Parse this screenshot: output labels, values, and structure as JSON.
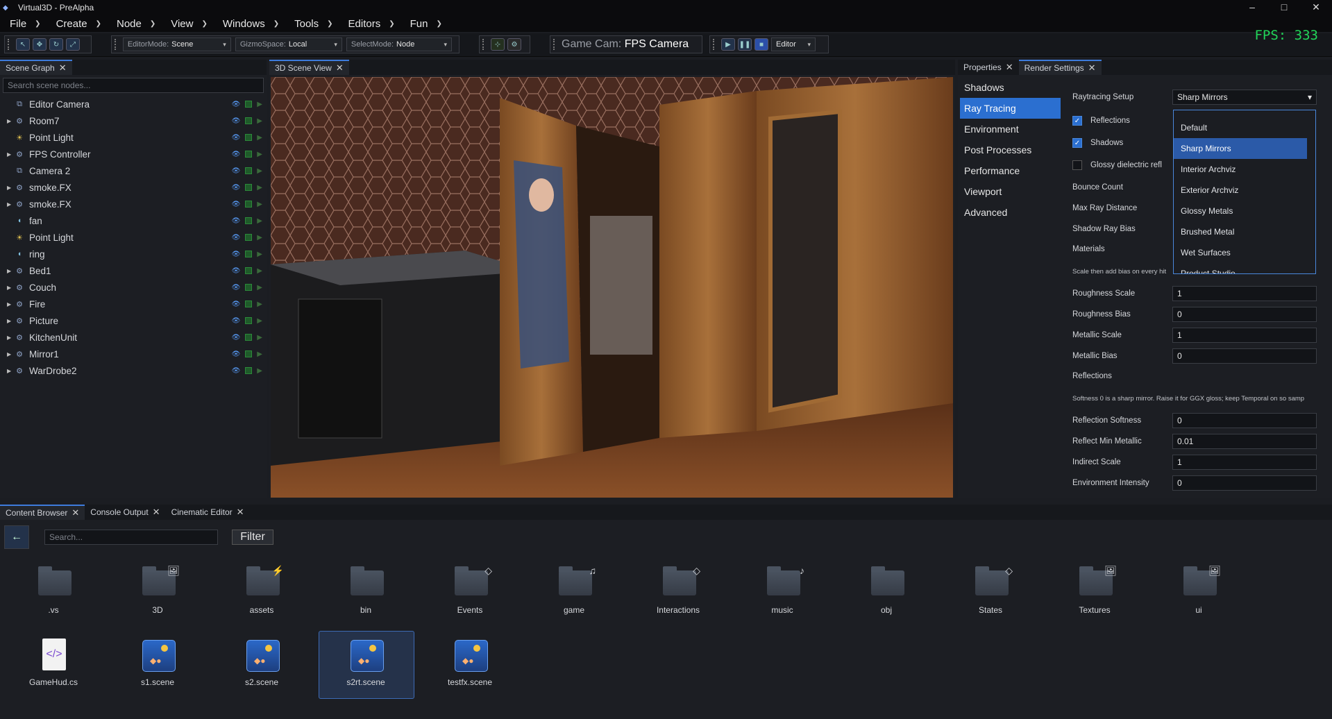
{
  "window": {
    "title": "Virtual3D - PreAlpha",
    "minimize": "–",
    "maximize": "□",
    "close": "✕"
  },
  "menu": [
    "File",
    "Create",
    "Node",
    "View",
    "Windows",
    "Tools",
    "Editors",
    "Fun"
  ],
  "toolbar": {
    "editor_mode_label": "EditorMode:",
    "editor_mode_value": "Scene",
    "gizmo_label": "GizmoSpace:",
    "gizmo_value": "Local",
    "select_label": "SelectMode:",
    "select_value": "Node",
    "game_cam_label": "Game Cam:",
    "game_cam_value": "FPS Camera",
    "play_target": "Editor"
  },
  "fps": "FPS: 333",
  "scene_graph": {
    "tab": "Scene Graph",
    "search_placeholder": "Search scene nodes...",
    "nodes": [
      {
        "name": "Editor Camera",
        "icon": "camera-icon"
      },
      {
        "name": "Room7",
        "icon": "node-icon"
      },
      {
        "name": "Point Light",
        "icon": "light-icon"
      },
      {
        "name": "FPS Controller",
        "icon": "node-icon"
      },
      {
        "name": "Camera 2",
        "icon": "camera-icon"
      },
      {
        "name": "smoke.FX",
        "icon": "node-icon"
      },
      {
        "name": "smoke.FX",
        "icon": "node-icon"
      },
      {
        "name": "fan",
        "icon": "sound-icon"
      },
      {
        "name": "Point Light",
        "icon": "light-icon"
      },
      {
        "name": "ring",
        "icon": "sound-icon"
      },
      {
        "name": "Bed1",
        "icon": "node-icon"
      },
      {
        "name": "Couch",
        "icon": "node-icon"
      },
      {
        "name": "Fire",
        "icon": "node-icon"
      },
      {
        "name": "Picture",
        "icon": "node-icon"
      },
      {
        "name": "KitchenUnit",
        "icon": "node-icon"
      },
      {
        "name": "Mirror1",
        "icon": "node-icon"
      },
      {
        "name": "WarDrobe2",
        "icon": "node-icon"
      }
    ]
  },
  "viewport": {
    "tab": "3D Scene View"
  },
  "render": {
    "tabs": [
      "Properties",
      "Render Settings"
    ],
    "sections": [
      "Shadows",
      "Ray Tracing",
      "Environment",
      "Post Processes",
      "Performance",
      "Viewport",
      "Advanced"
    ],
    "raytracing_setup_label": "Raytracing Setup",
    "raytracing_setup_value": "Sharp Mirrors",
    "reflections_label": "Reflections",
    "shadows_label": "Shadows",
    "glossy_label": "Glossy dielectric refl",
    "bounce_label": "Bounce Count",
    "max_ray_label": "Max Ray Distance",
    "shadow_bias_label": "Shadow Ray Bias",
    "materials_label": "Materials",
    "materials_note": "Scale then add bias on every hit",
    "fields": [
      {
        "label": "Roughness Scale",
        "value": "1"
      },
      {
        "label": "Roughness Bias",
        "value": "0"
      },
      {
        "label": "Metallic Scale",
        "value": "1"
      },
      {
        "label": "Metallic Bias",
        "value": "0"
      }
    ],
    "reflections_header": "Reflections",
    "reflections_note": "Softness 0 is a sharp mirror. Raise it for GGX gloss; keep Temporal on so samp",
    "fields2": [
      {
        "label": "Reflection Softness",
        "value": "0"
      },
      {
        "label": "Reflect Min Metallic",
        "value": "0.01"
      },
      {
        "label": "Indirect Scale",
        "value": "1"
      },
      {
        "label": "Environment Intensity",
        "value": "0"
      }
    ],
    "preset_options": [
      "Default",
      "Sharp Mirrors",
      "Interior Archviz",
      "Exterior Archviz",
      "Glossy Metals",
      "Brushed Metal",
      "Wet Surfaces",
      "Product Studio"
    ]
  },
  "bottom": {
    "tabs": [
      "Content Browser",
      "Console Output",
      "Cinematic Editor"
    ],
    "search_placeholder": "Search...",
    "filter": "Filter",
    "folders": [
      ".vs",
      "3D",
      "assets",
      "bin",
      "Events",
      "game",
      "Interactions",
      "music",
      "obj",
      "States",
      "Textures",
      "ui"
    ],
    "files": [
      "GameHud.cs",
      "s1.scene",
      "s2.scene",
      "s2rt.scene",
      "testfx.scene"
    ]
  }
}
